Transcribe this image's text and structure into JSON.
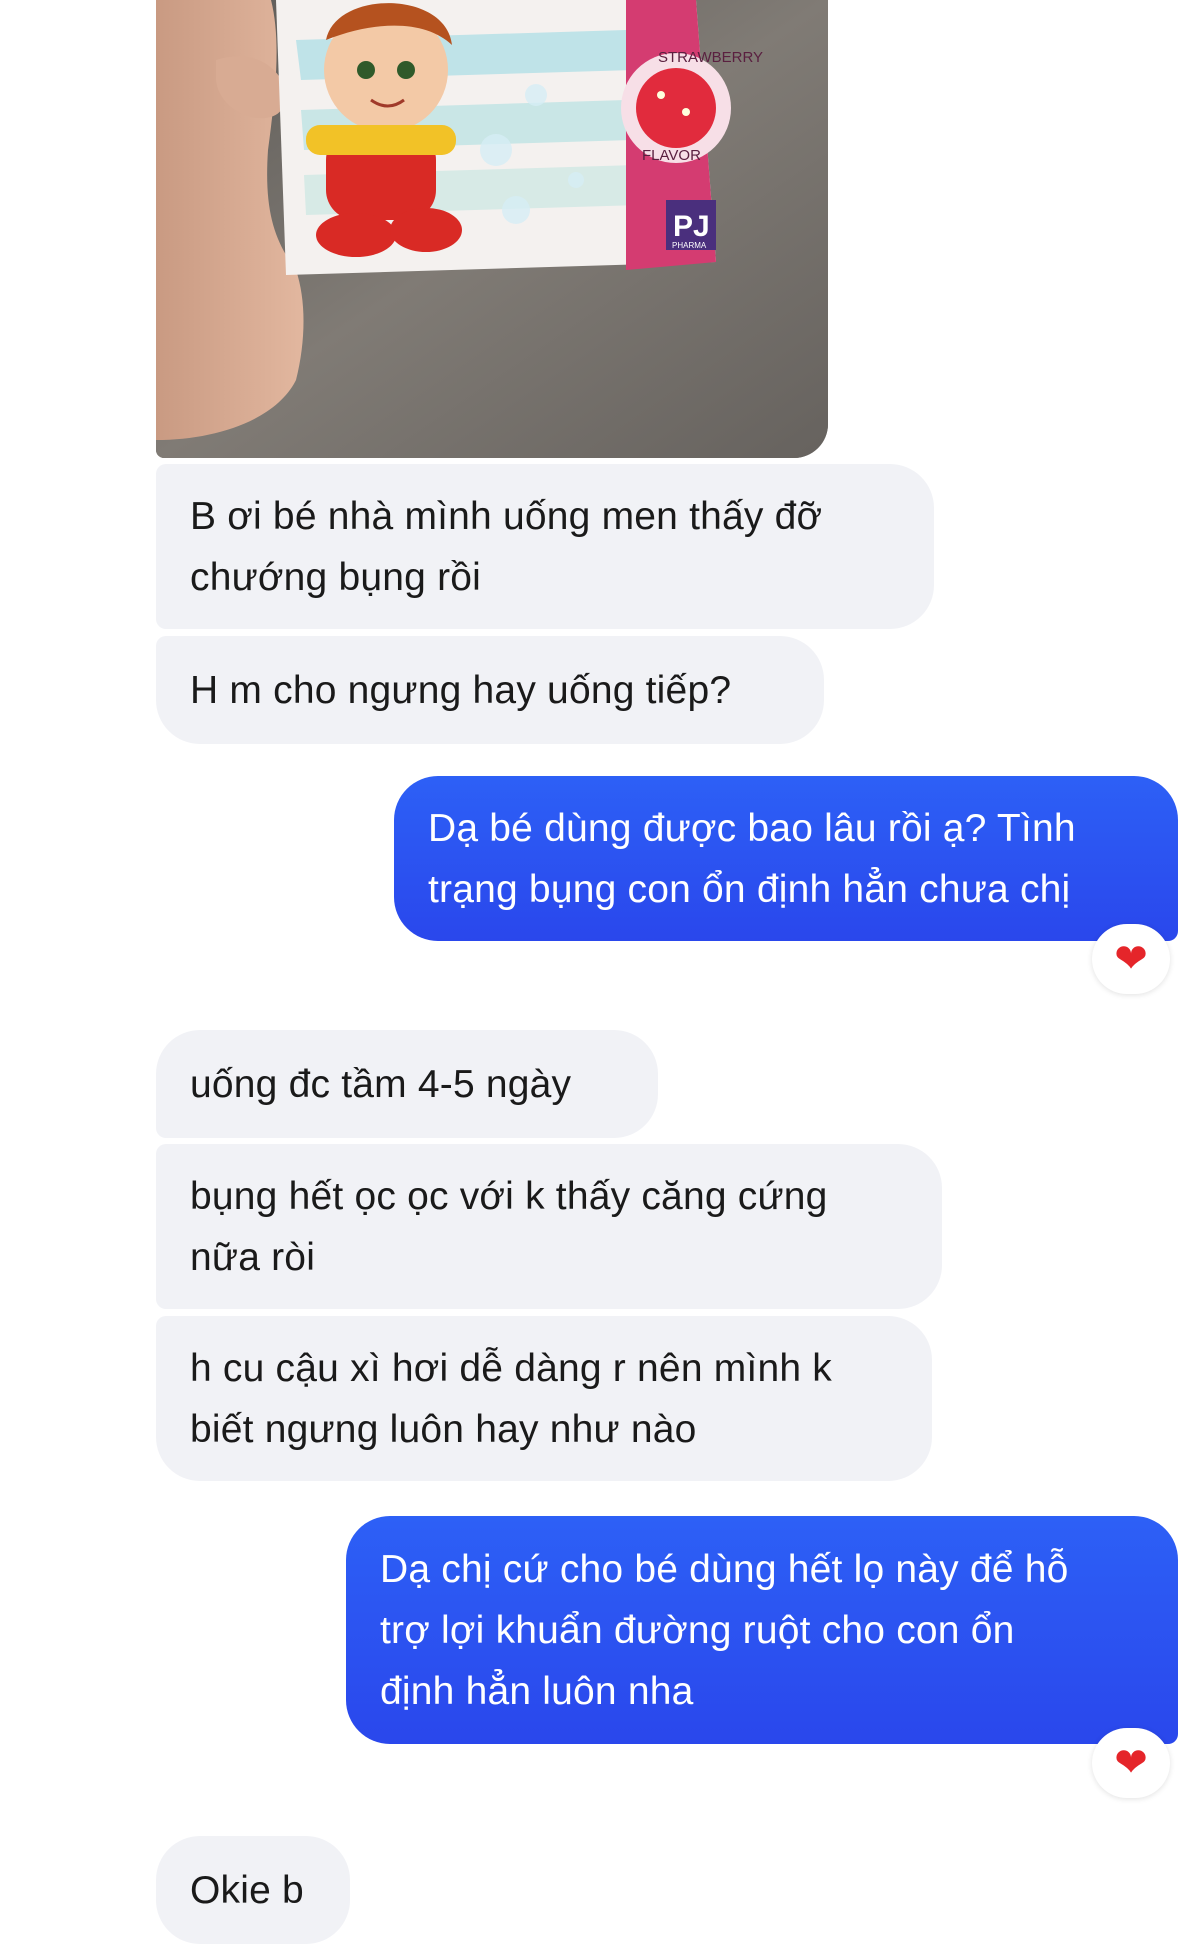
{
  "photo": {
    "label": "Strawberry flavor medicine box photo",
    "box_text": {
      "flavor_top": "STRAWBERRY",
      "flavor_bottom": "FLAVOR",
      "brand": "PJ",
      "brand_sub": "PHARMA"
    }
  },
  "messages": [
    {
      "from": "them",
      "text": "B ơi bé nhà mình uống men thấy đỡ\nchướng bụng rồi"
    },
    {
      "from": "them",
      "text": "H m cho ngưng hay uống tiếp?"
    },
    {
      "from": "me",
      "text": "Dạ bé dùng được bao lâu rồi ạ? Tình\ntrạng bụng con ổn định hẳn chưa chị",
      "reaction": "❤"
    },
    {
      "from": "them",
      "text": "uống đc tầm 4-5 ngày"
    },
    {
      "from": "them",
      "text": "bụng hết ọc ọc với k thấy căng cứng\nnữa ròi"
    },
    {
      "from": "them",
      "text": "h cu cậu xì hơi dễ dàng r nên mình k\nbiết ngưng luôn hay như nào"
    },
    {
      "from": "me",
      "text": "Dạ chị cứ cho bé dùng hết lọ này để hỗ\ntrợ lợi khuẩn đường ruột cho con ổn\nđịnh hẳn luôn nha",
      "reaction": "❤"
    },
    {
      "from": "them",
      "text": "Okie b"
    }
  ],
  "colors": {
    "incoming_bubble": "#f1f2f6",
    "outgoing_bubble": "#2a50f0",
    "reaction_heart": "#e5252a"
  }
}
